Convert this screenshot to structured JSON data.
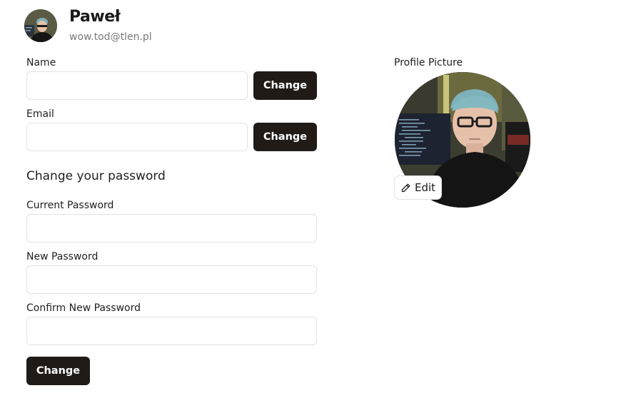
{
  "user": {
    "name": "Paweł",
    "email": "wow.tod@tlen.pl"
  },
  "form": {
    "name_label": "Name",
    "name_value": "",
    "name_change_label": "Change",
    "email_label": "Email",
    "email_value": "",
    "email_change_label": "Change",
    "password_section_title": "Change your password",
    "current_password_label": "Current Password",
    "current_password_value": "",
    "new_password_label": "New Password",
    "new_password_value": "",
    "confirm_password_label": "Confirm New Password",
    "confirm_password_value": "",
    "password_change_label": "Change"
  },
  "profile_picture": {
    "label": "Profile Picture",
    "edit_label": "Edit",
    "edit_icon": "pencil-icon"
  },
  "colors": {
    "button_bg": "#201b17",
    "button_text": "#ffffff",
    "email_text": "#7a7a7a",
    "input_border": "#e2e2e2"
  }
}
